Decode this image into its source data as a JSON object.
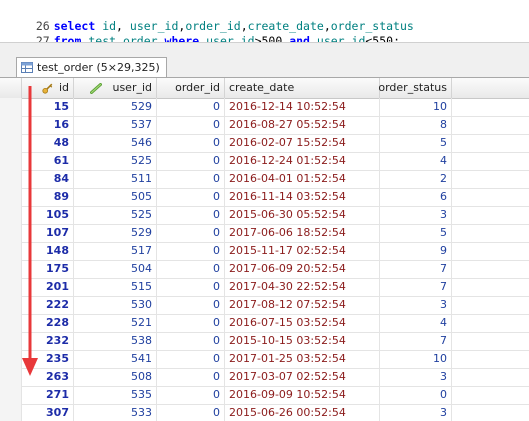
{
  "editor": {
    "lines": [
      {
        "num": "26",
        "parts": [
          {
            "t": "select",
            "k": "kw"
          },
          {
            "t": " ",
            "k": "op"
          },
          {
            "t": "id",
            "k": "id"
          },
          {
            "t": ", ",
            "k": "punc"
          },
          {
            "t": "user_id",
            "k": "id"
          },
          {
            "t": ",",
            "k": "punc"
          },
          {
            "t": "order_id",
            "k": "id"
          },
          {
            "t": ",",
            "k": "punc"
          },
          {
            "t": "create_date",
            "k": "id"
          },
          {
            "t": ",",
            "k": "punc"
          },
          {
            "t": "order_status",
            "k": "id"
          }
        ]
      },
      {
        "num": "27",
        "parts": [
          {
            "t": "from",
            "k": "kw"
          },
          {
            "t": " ",
            "k": "op"
          },
          {
            "t": "test_order",
            "k": "id"
          },
          {
            "t": " ",
            "k": "op"
          },
          {
            "t": "where",
            "k": "kw"
          },
          {
            "t": " ",
            "k": "op"
          },
          {
            "t": "user_id",
            "k": "id"
          },
          {
            "t": ">500 ",
            "k": "op"
          },
          {
            "t": "and",
            "k": "kw"
          },
          {
            "t": " ",
            "k": "op"
          },
          {
            "t": "user_id",
            "k": "id"
          },
          {
            "t": "<550;",
            "k": "op"
          }
        ]
      }
    ]
  },
  "tab": {
    "label": "test_order (5×29,325)"
  },
  "grid": {
    "columns": [
      "id",
      "user_id",
      "order_id",
      "create_date",
      "order_status"
    ],
    "rows": [
      [
        "15",
        "529",
        "0",
        "2016-12-14 10:52:54",
        "10"
      ],
      [
        "16",
        "537",
        "0",
        "2016-08-27 05:52:54",
        "8"
      ],
      [
        "48",
        "546",
        "0",
        "2016-02-07 15:52:54",
        "5"
      ],
      [
        "61",
        "525",
        "0",
        "2016-12-24 01:52:54",
        "4"
      ],
      [
        "84",
        "511",
        "0",
        "2016-04-01 01:52:54",
        "2"
      ],
      [
        "89",
        "505",
        "0",
        "2016-11-14 03:52:54",
        "6"
      ],
      [
        "105",
        "525",
        "0",
        "2015-06-30 05:52:54",
        "3"
      ],
      [
        "107",
        "529",
        "0",
        "2017-06-06 18:52:54",
        "5"
      ],
      [
        "148",
        "517",
        "0",
        "2015-11-17 02:52:54",
        "9"
      ],
      [
        "175",
        "504",
        "0",
        "2017-06-09 20:52:54",
        "7"
      ],
      [
        "201",
        "515",
        "0",
        "2017-04-30 22:52:54",
        "7"
      ],
      [
        "222",
        "530",
        "0",
        "2017-08-12 07:52:54",
        "3"
      ],
      [
        "228",
        "521",
        "0",
        "2016-07-15 03:52:54",
        "4"
      ],
      [
        "232",
        "538",
        "0",
        "2015-10-15 03:52:54",
        "7"
      ],
      [
        "235",
        "541",
        "0",
        "2017-01-25 03:52:54",
        "10"
      ],
      [
        "263",
        "508",
        "0",
        "2017-03-07 02:52:54",
        "3"
      ],
      [
        "271",
        "535",
        "0",
        "2016-09-09 10:52:54",
        "0"
      ],
      [
        "307",
        "533",
        "0",
        "2015-06-26 00:52:54",
        "3"
      ]
    ]
  },
  "colors": {
    "arrow": "#e8383a",
    "keyword": "#0000ff",
    "identifier": "#008080"
  },
  "icons": {
    "id_column": "key-icon",
    "user_id_column": "link-icon",
    "tab": "table-icon"
  }
}
